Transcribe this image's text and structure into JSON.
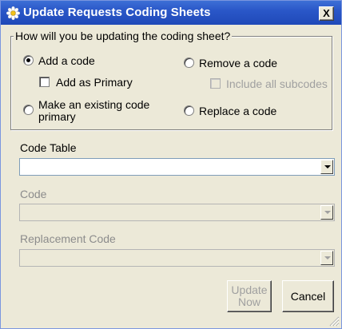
{
  "window": {
    "title": "Update Requests Coding Sheets",
    "close_glyph": "X"
  },
  "group": {
    "legend": "How will you be updating the coding sheet?",
    "options": {
      "add_code": "Add a code",
      "add_as_primary": "Add as Primary",
      "make_primary_line1": "Make an existing code",
      "make_primary_line2": "primary",
      "remove_code": "Remove a code",
      "include_subcodes": "Include all subcodes",
      "replace_code": "Replace a code"
    },
    "selected": "add_code"
  },
  "fields": {
    "code_table_label": "Code Table",
    "code_table_value": "",
    "code_label": "Code",
    "code_value": "",
    "replacement_label": "Replacement Code",
    "replacement_value": ""
  },
  "buttons": {
    "update_line1": "Update",
    "update_line2": "Now",
    "cancel": "Cancel"
  },
  "icons": {
    "app": "flower-icon",
    "close": "close-icon",
    "dropdown": "chevron-down-icon",
    "grip": "resize-grip-icon"
  },
  "colors": {
    "titlebar": "#2a57c8",
    "dialog_bg": "#ece9d8",
    "disabled_text": "#a0a0a0"
  }
}
